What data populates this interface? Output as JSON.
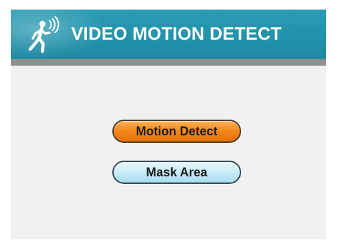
{
  "header": {
    "title": "VIDEO MOTION DETECT",
    "icon": "walking-person-wireless-icon",
    "color": "#2299b2"
  },
  "buttons": {
    "motion_detect_label": "Motion Detect",
    "motion_detect_color": "#f28a1e",
    "mask_area_label": "Mask Area",
    "mask_area_color": "#c9ecf7"
  }
}
